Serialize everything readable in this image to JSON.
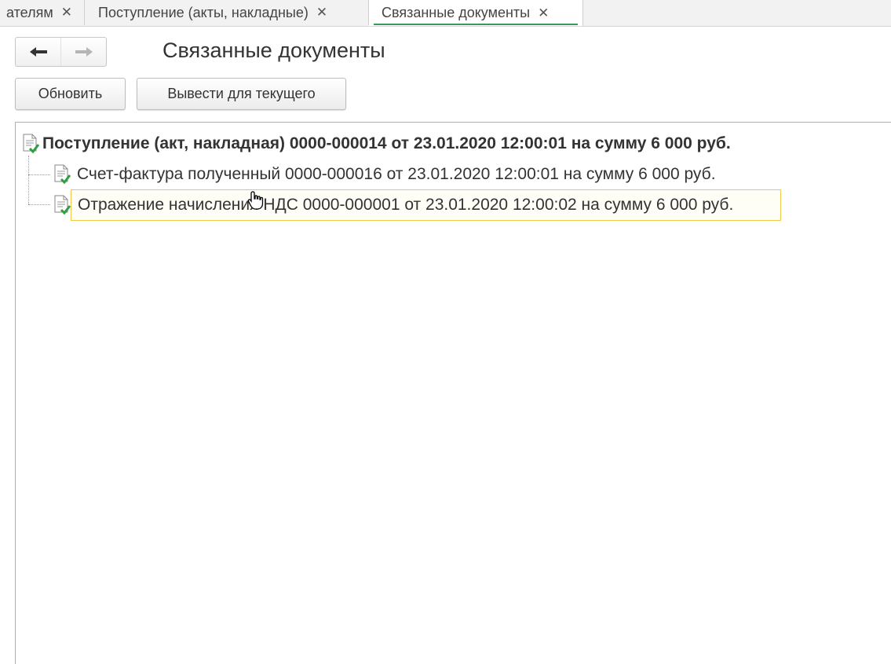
{
  "tabs": [
    {
      "label": "ателям",
      "close": "✕",
      "active": false
    },
    {
      "label": "Поступление (акты, накладные)",
      "close": "✕",
      "active": false
    },
    {
      "label": "Связанные документы",
      "close": "✕",
      "active": true
    }
  ],
  "nav": {
    "back_icon": "arrow-left-icon",
    "forward_icon": "arrow-right-icon"
  },
  "page": {
    "title": "Связанные документы"
  },
  "toolbar": {
    "refresh_label": "Обновить",
    "show_current_label": "Вывести для текущего"
  },
  "tree": {
    "root": {
      "text": "Поступление (акт, накладная) 0000-000014 от 23.01.2020 12:00:01 на сумму 6 000 руб.",
      "icon": "document-posted-icon"
    },
    "children": [
      {
        "text": "Счет-фактура полученный 0000-000016 от 23.01.2020 12:00:01 на сумму 6 000 руб.",
        "icon": "document-posted-icon",
        "selected": false
      },
      {
        "text": "Отражение начисления НДС 0000-000001 от 23.01.2020 12:00:02 на сумму 6 000 руб.",
        "icon": "document-posted-icon",
        "selected": true
      }
    ]
  },
  "colors": {
    "active_tab_underline": "#3a9a5a",
    "selection_border": "#f0c84a",
    "check_green": "#2e9e3e"
  }
}
